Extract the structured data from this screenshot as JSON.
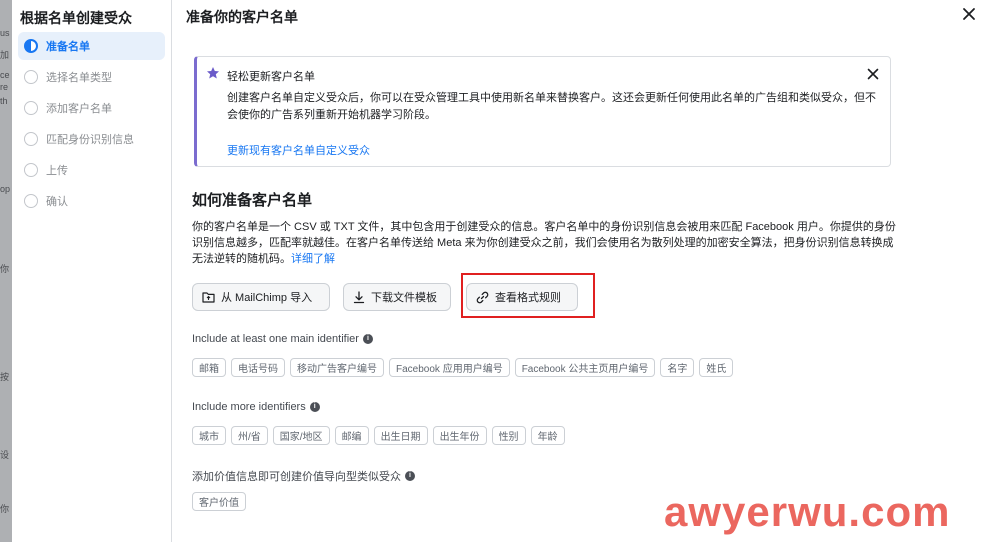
{
  "background_strip": {
    "fragments": [
      "us",
      "加",
      "ce",
      "re",
      "th",
      "op",
      "你",
      "按",
      "设",
      "你"
    ]
  },
  "sidebar": {
    "title": "根据名单创建受众",
    "steps": [
      {
        "label": "准备名单",
        "active": true
      },
      {
        "label": "选择名单类型",
        "active": false
      },
      {
        "label": "添加客户名单",
        "active": false
      },
      {
        "label": "匹配身份识别信息",
        "active": false
      },
      {
        "label": "上传",
        "active": false
      },
      {
        "label": "确认",
        "active": false
      }
    ]
  },
  "dialog": {
    "title": "准备你的客户名单",
    "close_icon": "close-icon",
    "notice": {
      "icon": "star-icon",
      "title": "轻松更新客户名单",
      "body": "创建客户名单自定义受众后，你可以在受众管理工具中使用新名单来替换客户。这还会更新任何使用此名单的广告组和类似受众，但不会使你的广告系列重新开始机器学习阶段。",
      "link": "更新现有客户名单自定义受众"
    },
    "section_title": "如何准备客户名单",
    "description": "你的客户名单是一个 CSV 或 TXT 文件，其中包含用于创建受众的信息。客户名单中的身份识别信息会被用来匹配 Facebook 用户。你提供的身份识别信息越多，匹配率就越佳。在客户名单传送给 Meta 来为你创建受众之前，我们会使用名为散列处理的加密安全算法，把身份识别信息转换成无法逆转的随机码。",
    "learn_more": "详细了解",
    "buttons": {
      "mailchimp": "从 MailChimp 导入",
      "download": "下载文件模板",
      "format": "查看格式规则"
    },
    "groups": [
      {
        "label": "Include at least one main identifier",
        "chips": [
          "邮箱",
          "电话号码",
          "移动广告客户编号",
          "Facebook 应用用户编号",
          "Facebook 公共主页用户编号",
          "名字",
          "姓氏"
        ]
      },
      {
        "label": "Include more identifiers",
        "chips": [
          "城市",
          "州/省",
          "国家/地区",
          "邮编",
          "出生日期",
          "出生年份",
          "性别",
          "年龄"
        ]
      },
      {
        "label": "添加价值信息即可创建价值导向型类似受众",
        "chips": [
          "客户价值"
        ]
      }
    ]
  },
  "watermark": "awyerwu.com",
  "colors": {
    "accent": "#1877f2",
    "highlight": "#e02020",
    "notice_border": "#7b6ccf",
    "watermark": "#e6463c"
  }
}
